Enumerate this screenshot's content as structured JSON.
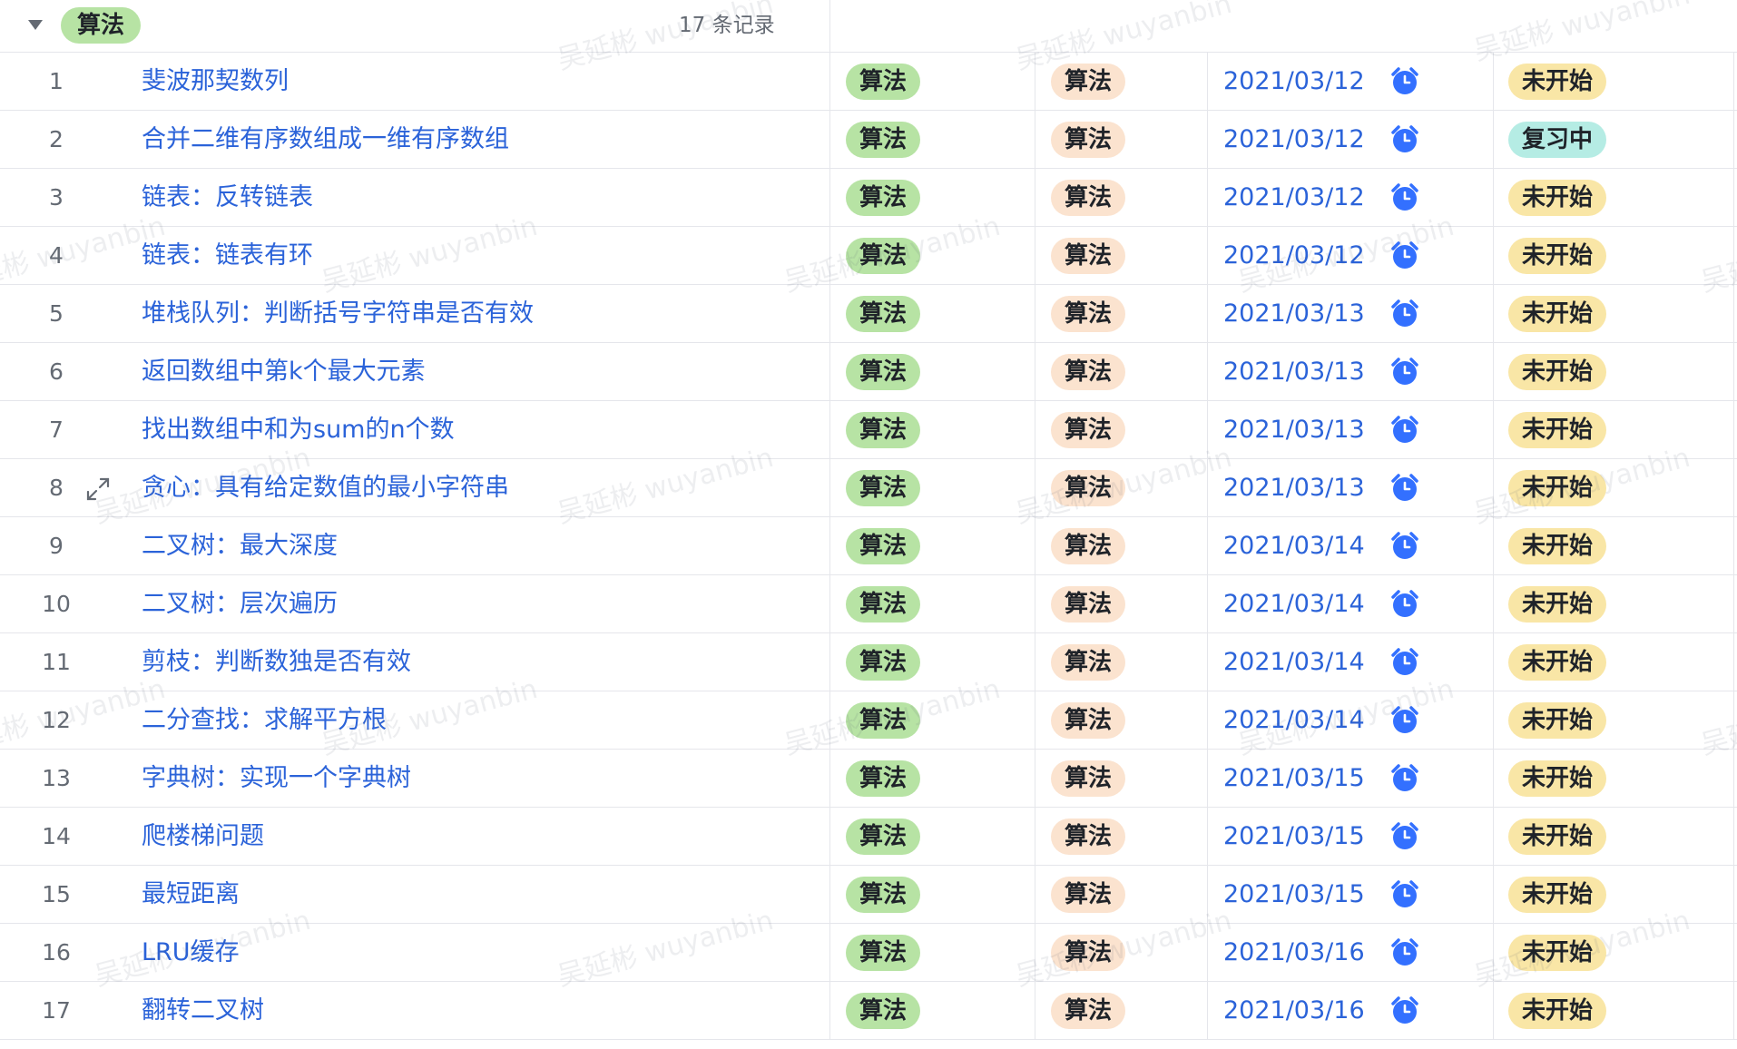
{
  "group": {
    "tag": "算法",
    "count_label": "17 条记录"
  },
  "watermark_text": "吴延彬 wuyanbin",
  "colors": {
    "link_blue": "#2b63d9",
    "category_green": "#b7e3a4",
    "type_peach": "#fbe3cf",
    "status_not_started": "#f9e6a6",
    "status_reviewing": "#b5ece4",
    "alarm_blue": "#3370ff"
  },
  "icons": {
    "collapse": "caret-down-icon",
    "expand": "expand-arrows-icon",
    "reminder": "alarm-clock-icon"
  },
  "rows": [
    {
      "index": "1",
      "title": "斐波那契数列",
      "category": "算法",
      "type": "算法",
      "date": "2021/03/12",
      "status": "未开始"
    },
    {
      "index": "2",
      "title": "合并二维有序数组成一维有序数组",
      "category": "算法",
      "type": "算法",
      "date": "2021/03/12",
      "status": "复习中"
    },
    {
      "index": "3",
      "title": "链表：反转链表",
      "category": "算法",
      "type": "算法",
      "date": "2021/03/12",
      "status": "未开始"
    },
    {
      "index": "4",
      "title": "链表：链表有环",
      "category": "算法",
      "type": "算法",
      "date": "2021/03/12",
      "status": "未开始"
    },
    {
      "index": "5",
      "title": "堆栈队列：判断括号字符串是否有效",
      "category": "算法",
      "type": "算法",
      "date": "2021/03/13",
      "status": "未开始"
    },
    {
      "index": "6",
      "title": "返回数组中第k个最大元素",
      "category": "算法",
      "type": "算法",
      "date": "2021/03/13",
      "status": "未开始"
    },
    {
      "index": "7",
      "title": "找出数组中和为sum的n个数",
      "category": "算法",
      "type": "算法",
      "date": "2021/03/13",
      "status": "未开始"
    },
    {
      "index": "8",
      "title": "贪心：具有给定数值的最小字符串",
      "category": "算法",
      "type": "算法",
      "date": "2021/03/13",
      "status": "未开始"
    },
    {
      "index": "9",
      "title": "二叉树：最大深度",
      "category": "算法",
      "type": "算法",
      "date": "2021/03/14",
      "status": "未开始"
    },
    {
      "index": "10",
      "title": "二叉树：层次遍历",
      "category": "算法",
      "type": "算法",
      "date": "2021/03/14",
      "status": "未开始"
    },
    {
      "index": "11",
      "title": "剪枝：判断数独是否有效",
      "category": "算法",
      "type": "算法",
      "date": "2021/03/14",
      "status": "未开始"
    },
    {
      "index": "12",
      "title": "二分查找：求解平方根",
      "category": "算法",
      "type": "算法",
      "date": "2021/03/14",
      "status": "未开始"
    },
    {
      "index": "13",
      "title": "字典树：实现一个字典树",
      "category": "算法",
      "type": "算法",
      "date": "2021/03/15",
      "status": "未开始"
    },
    {
      "index": "14",
      "title": "爬楼梯问题",
      "category": "算法",
      "type": "算法",
      "date": "2021/03/15",
      "status": "未开始"
    },
    {
      "index": "15",
      "title": "最短距离",
      "category": "算法",
      "type": "算法",
      "date": "2021/03/15",
      "status": "未开始"
    },
    {
      "index": "16",
      "title": "LRU缓存",
      "category": "算法",
      "type": "算法",
      "date": "2021/03/16",
      "status": "未开始"
    },
    {
      "index": "17",
      "title": "翻转二叉树",
      "category": "算法",
      "type": "算法",
      "date": "2021/03/16",
      "status": "未开始"
    }
  ]
}
